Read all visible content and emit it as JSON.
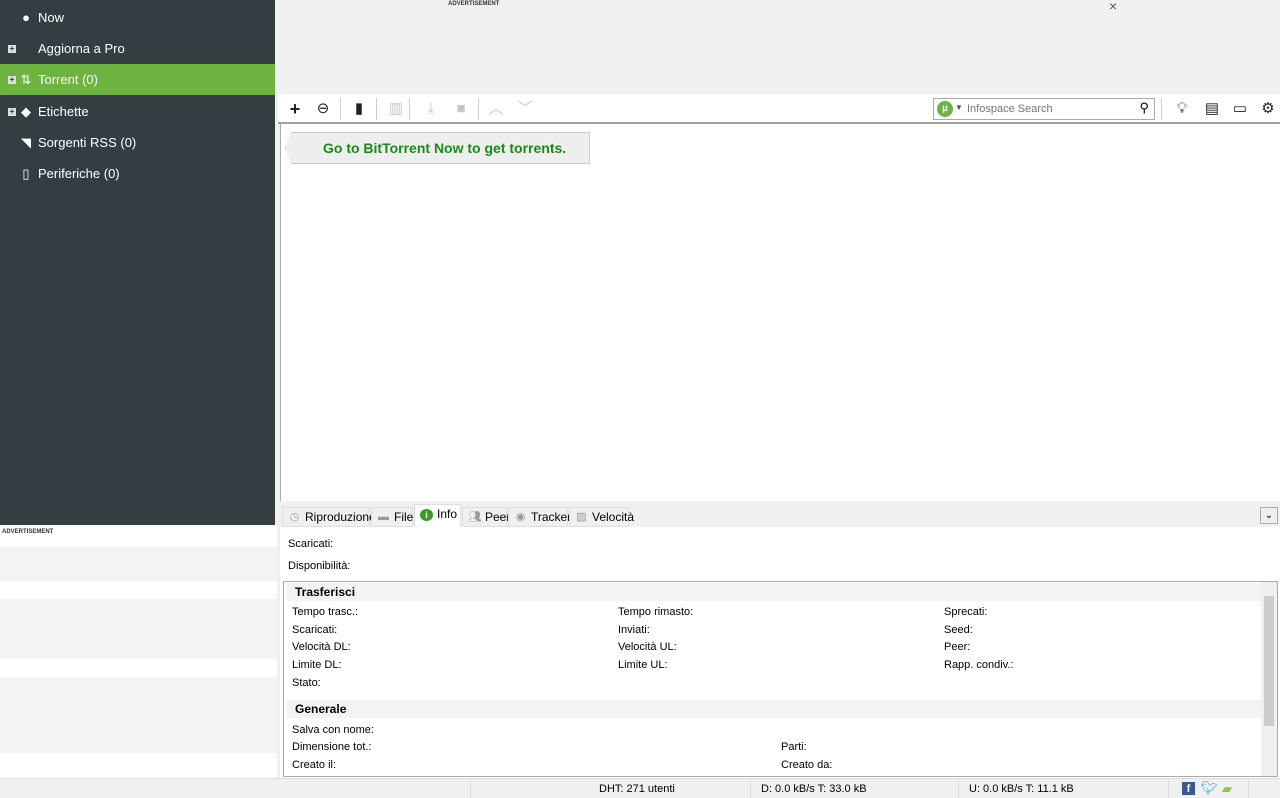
{
  "sidebar": {
    "items": [
      {
        "label": "Now",
        "icon": "bittorrent-now-icon",
        "expandable": false
      },
      {
        "label": "Aggiorna a Pro",
        "icon": "",
        "expandable": true
      },
      {
        "label": "Torrent (0)",
        "icon": "transfer-arrows-icon",
        "expandable": true,
        "active": true
      },
      {
        "label": "Etichette",
        "icon": "tag-icon",
        "expandable": true
      },
      {
        "label": "Sorgenti RSS (0)",
        "icon": "rss-icon",
        "expandable": false
      },
      {
        "label": "Periferiche (0)",
        "icon": "device-icon",
        "expandable": false
      }
    ],
    "ad_label": "ADVERTISEMENT"
  },
  "top_ad": {
    "label": "ADVERTISEMENT",
    "close": "×"
  },
  "toolbar": {
    "search_placeholder": "Infospace Search"
  },
  "main": {
    "go_now": "Go to BitTorrent Now to get torrents."
  },
  "tabs": [
    {
      "label": "Riproduzione"
    },
    {
      "label": "File"
    },
    {
      "label": "Info",
      "active": true
    },
    {
      "label": "Peer"
    },
    {
      "label": "Tracker"
    },
    {
      "label": "Velocità"
    }
  ],
  "info": {
    "scaricati": "Scaricati:",
    "disponibilita": "Disponibilità:",
    "trasferisci": {
      "title": "Trasferisci",
      "fields": [
        "Tempo trasc.:",
        "Tempo rimasto:",
        "Sprecati:",
        "Scaricati:",
        "Inviati:",
        "Seed:",
        "Velocità DL:",
        "Velocità UL:",
        "Peer:",
        "Limite DL:",
        "Limite UL:",
        "Rapp. condiv.:",
        "Stato:"
      ]
    },
    "generale": {
      "title": "Generale",
      "fields": [
        "Salva con nome:",
        "Dimensione tot.:",
        "Parti:",
        "Creato il:",
        "Creato da:"
      ]
    }
  },
  "status": {
    "dht": "DHT: 271 utenti",
    "down": "D: 0.0 kB/s T: 33.0 kB",
    "up": "U: 0.0 kB/s T: 11.1 kB"
  },
  "colors": {
    "accent": "#6db33f",
    "sidebar": "#343d42",
    "link_green": "#1a8a1a"
  }
}
